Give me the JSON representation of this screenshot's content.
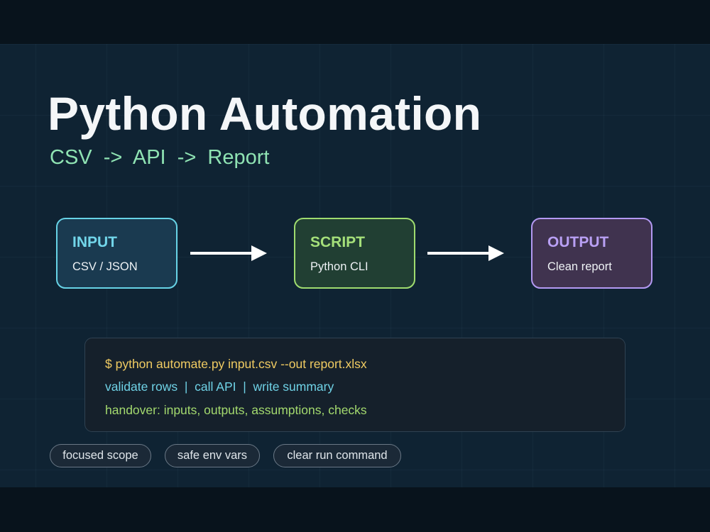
{
  "title": "Python Automation",
  "subtitle": "CSV  ->  API  ->  Report",
  "flow": {
    "nodes": [
      {
        "label": "INPUT",
        "description": "CSV / JSON",
        "accent": "#67d3e6"
      },
      {
        "label": "SCRIPT",
        "description": "Python CLI",
        "accent": "#9fdc6f"
      },
      {
        "label": "OUTPUT",
        "description": "Clean report",
        "accent": "#b399f2"
      }
    ]
  },
  "terminal": {
    "command": "$ python automate.py input.csv --out report.xlsx",
    "steps": "validate rows  |  call API  |  write summary",
    "handover": "handover: inputs, outputs, assumptions, checks"
  },
  "pills": [
    "focused scope",
    "safe env vars",
    "clear run command"
  ],
  "colors": {
    "background": "#0f2333",
    "title": "#f4f6f8",
    "subtitle": "#8fe3b3",
    "command": "#f0cb62",
    "steps": "#6fd2e6",
    "handover": "#a3d96e"
  }
}
